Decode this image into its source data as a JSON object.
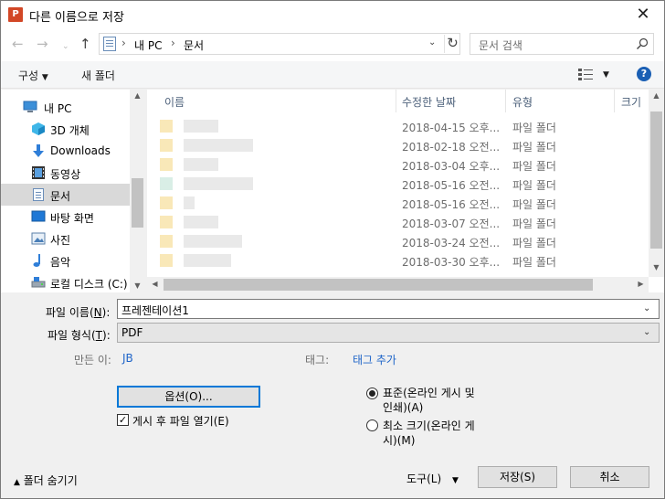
{
  "window": {
    "title": "다른 이름으로 저장",
    "app_icon_letter": "P"
  },
  "nav": {
    "path": [
      "내 PC",
      "문서"
    ],
    "search_placeholder": "문서 검색"
  },
  "toolbar": {
    "organize": "구성",
    "new_folder": "새 폴더"
  },
  "sidebar": {
    "items": [
      {
        "label": "내 PC",
        "icon": "computer-icon"
      },
      {
        "label": "3D 개체",
        "icon": "3d-objects-icon"
      },
      {
        "label": "Downloads",
        "icon": "download-icon"
      },
      {
        "label": "동영상",
        "icon": "video-icon"
      },
      {
        "label": "문서",
        "icon": "document-icon"
      },
      {
        "label": "바탕 화면",
        "icon": "desktop-icon"
      },
      {
        "label": "사진",
        "icon": "pictures-icon"
      },
      {
        "label": "음악",
        "icon": "music-icon"
      },
      {
        "label": "로컬 디스크 (C:)",
        "icon": "drive-icon"
      }
    ]
  },
  "files": {
    "columns": [
      "이름",
      "수정한 날짜",
      "유형",
      "크기"
    ],
    "rows": [
      {
        "date": "2018-04-15 오후...",
        "type": "파일 폴더"
      },
      {
        "date": "2018-02-18 오전...",
        "type": "파일 폴더"
      },
      {
        "date": "2018-03-04 오후...",
        "type": "파일 폴더"
      },
      {
        "date": "2018-05-16 오전...",
        "type": "파일 폴더"
      },
      {
        "date": "2018-05-16 오전...",
        "type": "파일 폴더"
      },
      {
        "date": "2018-03-07 오전...",
        "type": "파일 폴더"
      },
      {
        "date": "2018-03-24 오전...",
        "type": "파일 폴더"
      },
      {
        "date": "2018-03-30 오후...",
        "type": "파일 폴더"
      }
    ]
  },
  "form": {
    "filename_label": "파일 이름(",
    "filename_key": "N",
    "filename_value": "프레젠테이션1",
    "filetype_label": "파일 형식(",
    "filetype_key": "T",
    "filetype_value": "PDF",
    "author_label": "만든 이:",
    "author_value": "JB",
    "tags_label": "태그:",
    "tags_value": "태그 추가",
    "options_button": "옵션(O)...",
    "open_after_publish": "게시 후 파일 열기(E)",
    "open_after_publish_checked": true,
    "opt_standard": "표준(온라인 게시 및",
    "opt_standard_2": "인쇄)(A)",
    "opt_minimum": "최소 크기(온라인 게",
    "opt_minimum_2": "시)(M)"
  },
  "footer": {
    "hide_folders": "폴더 숨기기",
    "tools": "도구(L)",
    "save": "저장(S)",
    "cancel": "취소"
  }
}
